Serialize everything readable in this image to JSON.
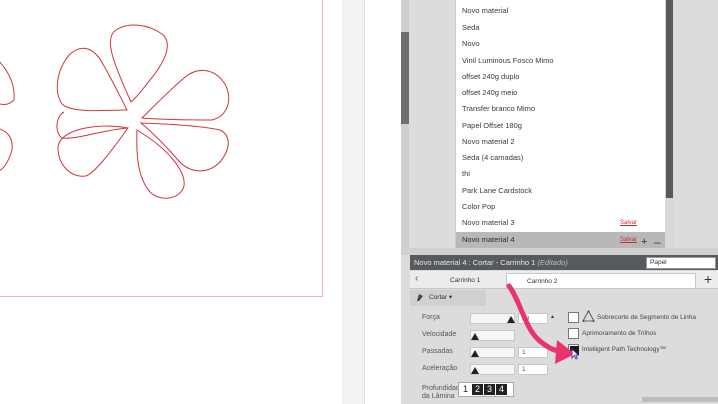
{
  "materials": [
    {
      "label": "Novo material",
      "link": ""
    },
    {
      "label": "Seda",
      "link": ""
    },
    {
      "label": "Novo",
      "link": ""
    },
    {
      "label": "Vinil Luminous Fosco Mimo",
      "link": ""
    },
    {
      "label": "offset 240g duplo",
      "link": ""
    },
    {
      "label": "offset 240g meio",
      "link": ""
    },
    {
      "label": "Transfer branco Mimo",
      "link": ""
    },
    {
      "label": "Papel Offset 180g",
      "link": ""
    },
    {
      "label": "Novo material 2",
      "link": ""
    },
    {
      "label": "Seda (4 camadas)",
      "link": ""
    },
    {
      "label": "thi",
      "link": ""
    },
    {
      "label": "Park Lane Cardstock",
      "link": ""
    },
    {
      "label": "Color Pop",
      "link": ""
    },
    {
      "label": "Novo material 3",
      "link": "Salvar"
    },
    {
      "label": "Novo material 4",
      "link": "Salvar"
    }
  ],
  "list_controls": {
    "add": "+",
    "remove": "–"
  },
  "status": {
    "title": "Novo material 4 : Cortar - Carrinho 1",
    "edited": "(Editado)",
    "material_type": "Papel"
  },
  "tabs": [
    {
      "label": "Carrinho 1"
    },
    {
      "label": "Carrinho 2"
    }
  ],
  "tab_add": "+",
  "tab_prev": "‹",
  "action": {
    "label": "Cortar ▾"
  },
  "settings": {
    "force": {
      "label": "Força",
      "value": "28"
    },
    "speed": {
      "label": "Velocidade",
      "value": ""
    },
    "passes": {
      "label": "Passadas",
      "value": "1"
    },
    "acceleration": {
      "label": "Aceleração",
      "value": "1"
    },
    "blade_depth": {
      "label": "Profundidade da Lâmina",
      "digits": [
        "1",
        "2",
        "3",
        "4"
      ]
    }
  },
  "options": [
    {
      "label": "Sobrecorte de Segmento de Linha",
      "checked": false
    },
    {
      "label": "Aprimoramento de Trilhos",
      "checked": false
    },
    {
      "label": "Intelligent Path Technology™",
      "checked": true
    }
  ],
  "colors": {
    "flower_stroke": "#d0363d",
    "accent_arrow": "#e8336f",
    "status_bar": "#555a5f",
    "panel_bg": "#dcdcdc"
  },
  "icons": {
    "cut": "blade-icon",
    "overcut": "triangle-nodes-icon",
    "cursor": "mouse-pointer-icon"
  }
}
